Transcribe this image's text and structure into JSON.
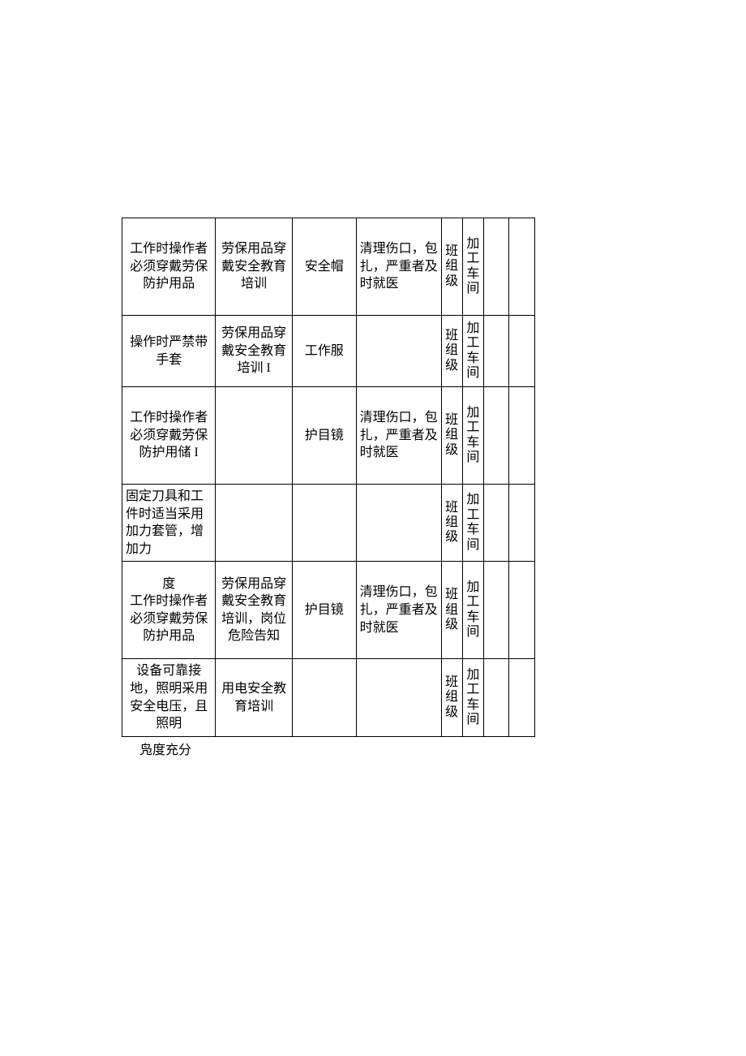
{
  "rows": [
    {
      "c0": "工作时操作者必须穿戴劳保防护用品",
      "c1": "劳保用品穿戴安全教育培训",
      "c2": "安全帽",
      "c3": "清理伤口，包扎，严重者及时就医",
      "c4": "班组级",
      "c5": "加工车间",
      "c6": "",
      "c7": ""
    },
    {
      "c0": "操作时严禁带手套",
      "c1": "劳保用品穿戴安全教育培训 I",
      "c2": "工作服",
      "c3": "",
      "c4": "班组级",
      "c5": "加工车间",
      "c6": "",
      "c7": ""
    },
    {
      "c0": "工作时操作者必须穿戴劳保防护用储 I",
      "c1": "",
      "c2": "护目镜",
      "c3": "清理伤口，包扎，严重者及时就医",
      "c4": "班组级",
      "c5": "加工车间",
      "c6": "",
      "c7": ""
    },
    {
      "c0": "固定刀具和工件时适当采用加力套管，增加力",
      "c1": "",
      "c2": "",
      "c3": "",
      "c4": "班组级",
      "c5": "加工车间",
      "c6": "",
      "c7": ""
    },
    {
      "c0": "度\n工作时操作者必须穿戴劳保防护用品",
      "c1": "劳保用品穿戴安全教育培训，岗位危险告知",
      "c2": "护目镜",
      "c3": "清理伤口，包扎，严重者及时就医",
      "c4": "班组级",
      "c5": "加工车间",
      "c6": "",
      "c7": ""
    },
    {
      "c0": "设备可靠接地，照明采用安全电压，且照明",
      "c1": "用电安全教育培训",
      "c2": "",
      "c3": "",
      "c4": "班组级",
      "c5": "加工车间",
      "c6": "",
      "c7": ""
    }
  ],
  "footer": "凫度充分"
}
